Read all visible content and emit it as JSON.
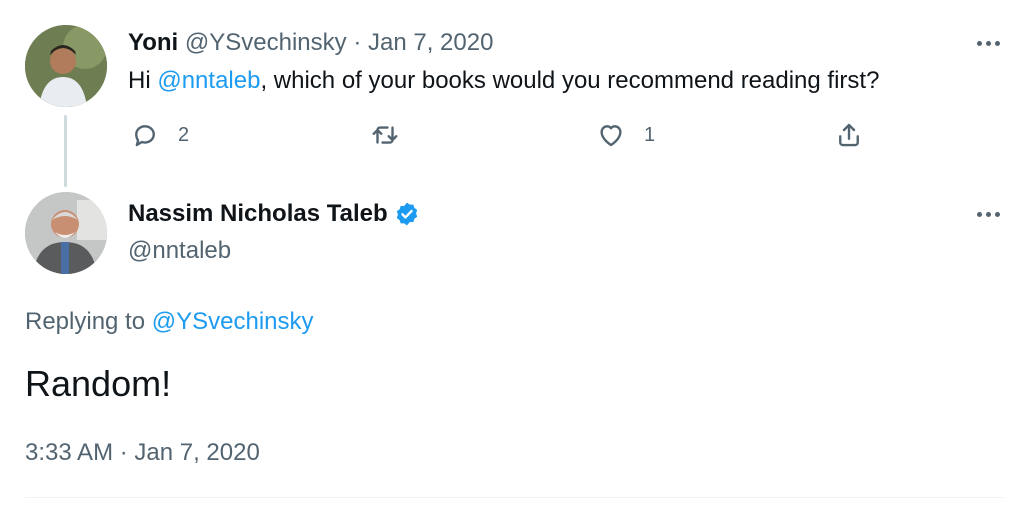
{
  "parent_tweet": {
    "display_name": "Yoni",
    "handle": "@YSvechinsky",
    "separator": "·",
    "date": "Jan 7, 2020",
    "text_prefix": "Hi ",
    "mention": "@nntaleb",
    "text_suffix": ", which of your books would you recommend reading first?",
    "reply_count": "2",
    "like_count": "1"
  },
  "main_tweet": {
    "display_name": "Nassim Nicholas Taleb",
    "handle": "@nntaleb",
    "replying_prefix": "Replying to ",
    "replying_to": "@YSvechinsky",
    "text": "Random!",
    "timestamp": "3:33 AM · Jan 7, 2020"
  },
  "icons": {
    "more": "more-icon",
    "reply": "reply-icon",
    "retweet": "retweet-icon",
    "like": "like-icon",
    "share": "share-icon",
    "verified": "verified-badge-icon"
  },
  "colors": {
    "link": "#1d9bf0",
    "secondary_text": "#536471",
    "primary_text": "#0f1419",
    "verified": "#1d9bf0"
  }
}
